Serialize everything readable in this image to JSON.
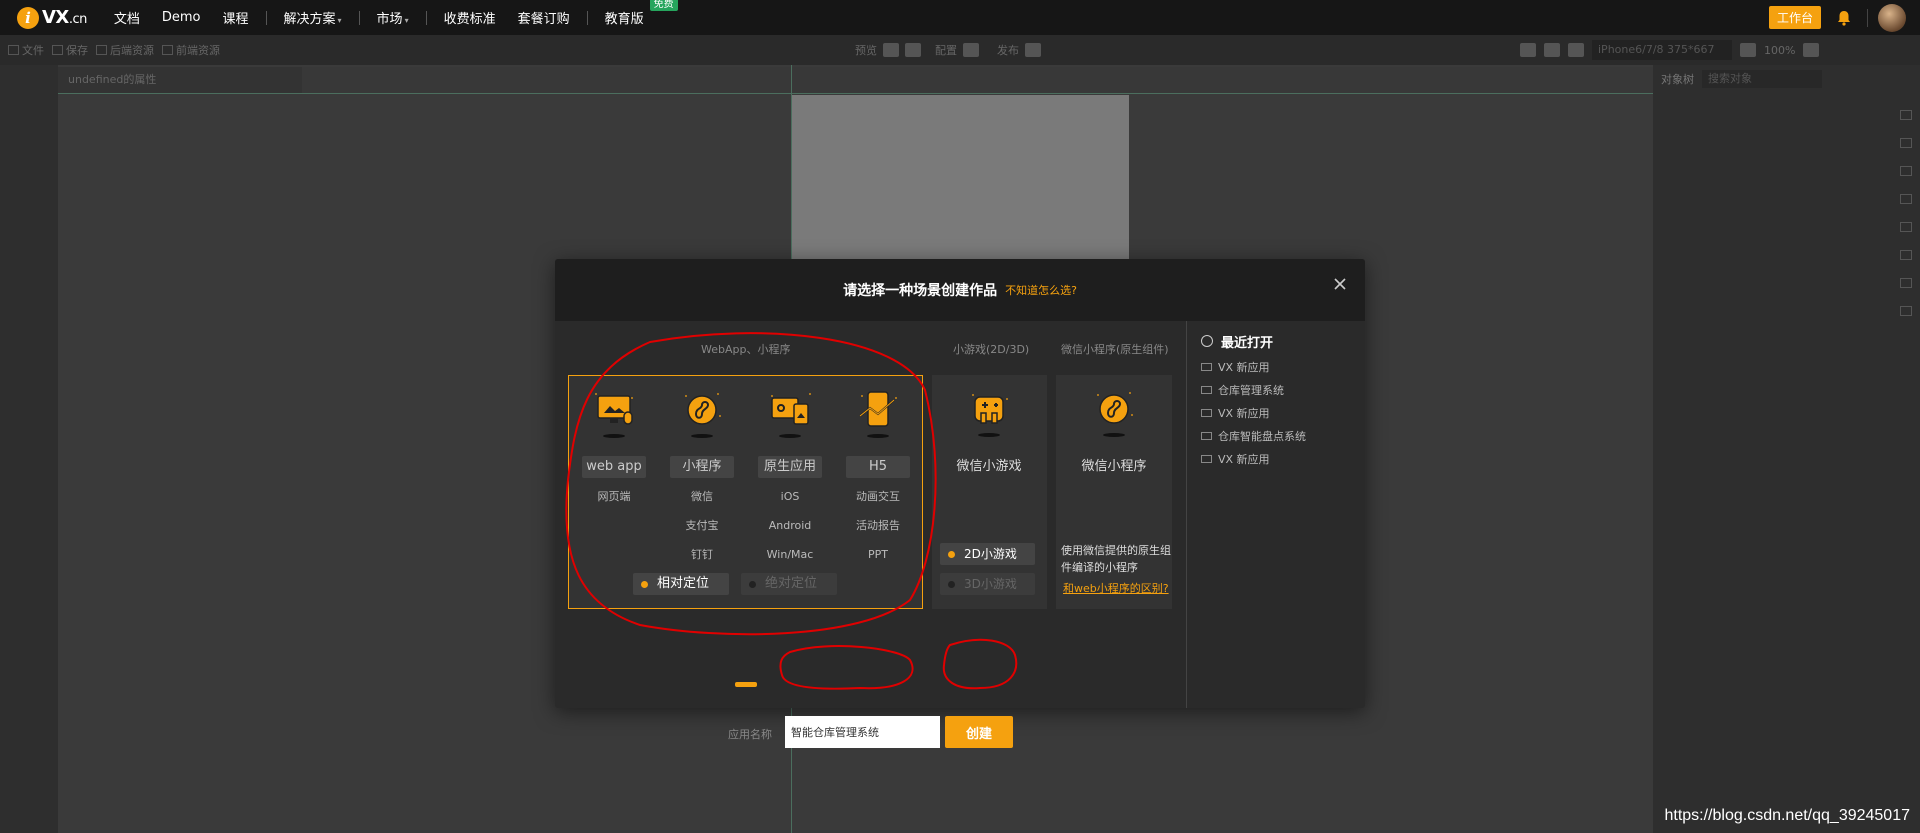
{
  "nav": {
    "logo_text": "VX",
    "logo_suffix": ".cn",
    "items": [
      "文档",
      "Demo",
      "课程",
      "解决方案",
      "市场",
      "收费标准",
      "套餐订购",
      "教育版"
    ],
    "free_badge": "免费",
    "workbench": "工作台"
  },
  "toolbar": {
    "file": "文件",
    "save": "保存",
    "backend_res": "后端资源",
    "frontend_res": "前端资源",
    "preview": "预览",
    "config": "配置",
    "publish": "发布",
    "device": "iPhone6/7/8 375*667",
    "zoom": "100%"
  },
  "panels": {
    "props_title": "undefined的属性",
    "tree_tab": "对象树",
    "search_placeholder": "搜索对象"
  },
  "modal": {
    "title": "请选择一种场景创建作品",
    "help_link": "不知道怎么选?",
    "section_webapp": "WebApp、小程序",
    "section_game": "小游戏(2D/3D)",
    "section_wx": "微信小程序(原生组件)",
    "categories": [
      {
        "label": "web app",
        "subs": [
          "网页端"
        ]
      },
      {
        "label": "小程序",
        "subs": [
          "微信",
          "支付宝",
          "钉钉"
        ]
      },
      {
        "label": "原生应用",
        "subs": [
          "iOS",
          "Android",
          "Win/Mac"
        ]
      },
      {
        "label": "H5",
        "subs": [
          "动画交互",
          "活动报告",
          "PPT"
        ]
      }
    ],
    "position_relative": "相对定位",
    "position_absolute": "绝对定位",
    "game_title": "微信小游戏",
    "game_2d": "2D小游戏",
    "game_3d": "3D小游戏",
    "wx_title": "微信小程序",
    "wx_desc": "使用微信提供的原生组件编译的小程序",
    "wx_link": "和web小程序的区别?",
    "app_name_label": "应用名称",
    "app_name_value": "智能仓库管理系统",
    "create_button": "创建",
    "recent_title": "最近打开",
    "recent_items": [
      "VX 新应用",
      "仓库管理系统",
      "VX 新应用",
      "仓库智能盘点系统",
      "VX 新应用"
    ]
  },
  "watermark": "https://blog.csdn.net/qq_39245017",
  "colors": {
    "accent": "#f5a10f",
    "annotation": "#e00000",
    "free_badge": "#26a55d"
  }
}
